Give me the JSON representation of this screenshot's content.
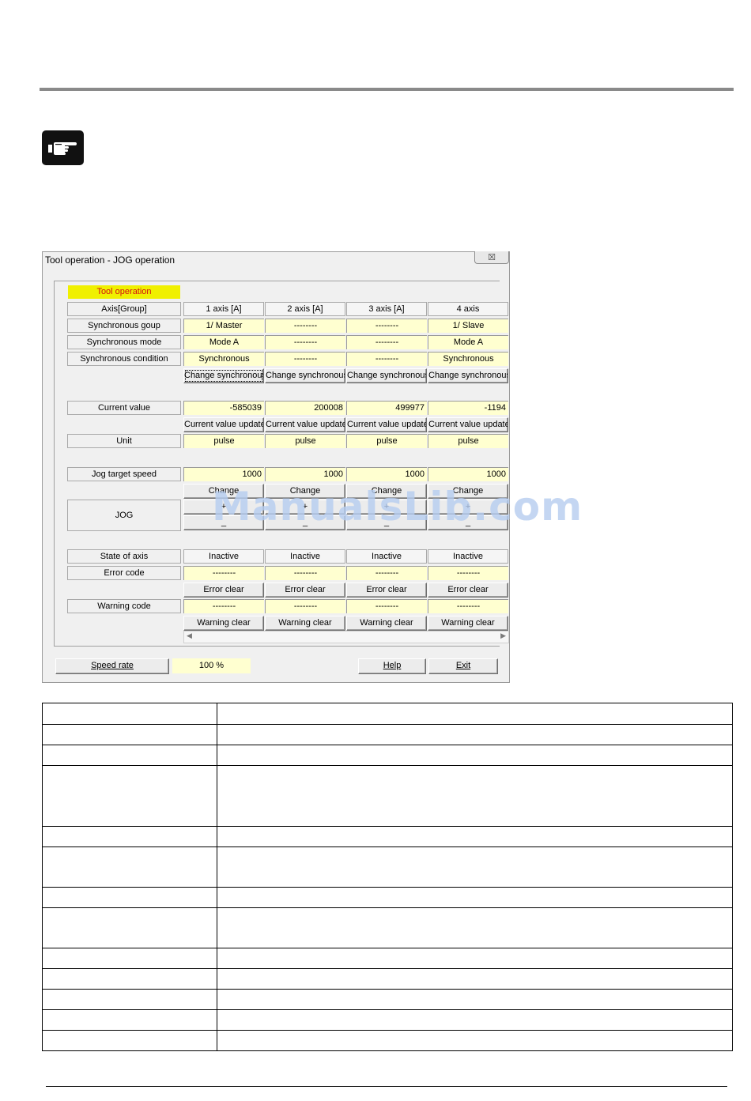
{
  "dialog": {
    "title": "Tool operation - JOG operation",
    "close_label": "☒",
    "tab_label": "Tool operation",
    "row_labels": {
      "axis": "Axis[Group]",
      "sync_group": "Synchronous goup",
      "sync_mode": "Synchronous mode",
      "sync_condition": "Synchronous condition",
      "current_value": "Current value",
      "unit": "Unit",
      "jog_speed": "Jog target speed",
      "jog": "JOG",
      "state": "State of axis",
      "error_code": "Error code",
      "warning_code": "Warning code"
    },
    "axes": [
      {
        "header": "1 axis [A]",
        "sync_group": "1/ Master",
        "sync_mode": "Mode A",
        "sync_condition": "Synchronous",
        "change_sync": "Change synchronous",
        "current_value": "-585039",
        "cv_update": "Current value update",
        "unit": "pulse",
        "jog_speed": "1000",
        "change": "Change",
        "jog_plus": "+",
        "jog_minus": "_",
        "state": "Inactive",
        "error_code": "--------",
        "error_clear": "Error clear",
        "warning_code": "--------",
        "warning_clear": "Warning clear"
      },
      {
        "header": "2 axis [A]",
        "sync_group": "--------",
        "sync_mode": "--------",
        "sync_condition": "--------",
        "change_sync": "Change synchronous",
        "current_value": "200008",
        "cv_update": "Current value update",
        "unit": "pulse",
        "jog_speed": "1000",
        "change": "Change",
        "jog_plus": "+",
        "jog_minus": "_",
        "state": "Inactive",
        "error_code": "--------",
        "error_clear": "Error clear",
        "warning_code": "--------",
        "warning_clear": "Warning clear"
      },
      {
        "header": "3 axis [A]",
        "sync_group": "--------",
        "sync_mode": "--------",
        "sync_condition": "--------",
        "change_sync": "Change synchronous",
        "current_value": "499977",
        "cv_update": "Current value update",
        "unit": "pulse",
        "jog_speed": "1000",
        "change": "Change",
        "jog_plus": "+",
        "jog_minus": "_",
        "state": "Inactive",
        "error_code": "--------",
        "error_clear": "Error clear",
        "warning_code": "--------",
        "warning_clear": "Warning clear"
      },
      {
        "header": "4 axis",
        "sync_group": "1/ Slave",
        "sync_mode": "Mode A",
        "sync_condition": "Synchronous",
        "change_sync": "Change synchronous",
        "current_value": "-1194",
        "cv_update": "Current value update",
        "unit": "pulse",
        "jog_speed": "1000",
        "change": "Change",
        "jog_plus": "+",
        "jog_minus": "_",
        "state": "Inactive",
        "error_code": "--------",
        "error_clear": "Error clear",
        "warning_code": "--------",
        "warning_clear": "Warning clear"
      }
    ],
    "footer": {
      "speed_rate_label": "Speed rate",
      "speed_rate_value": "100 %",
      "help_label": "Help",
      "exit_label": "Exit"
    }
  },
  "watermark": "ManualsLib.com"
}
